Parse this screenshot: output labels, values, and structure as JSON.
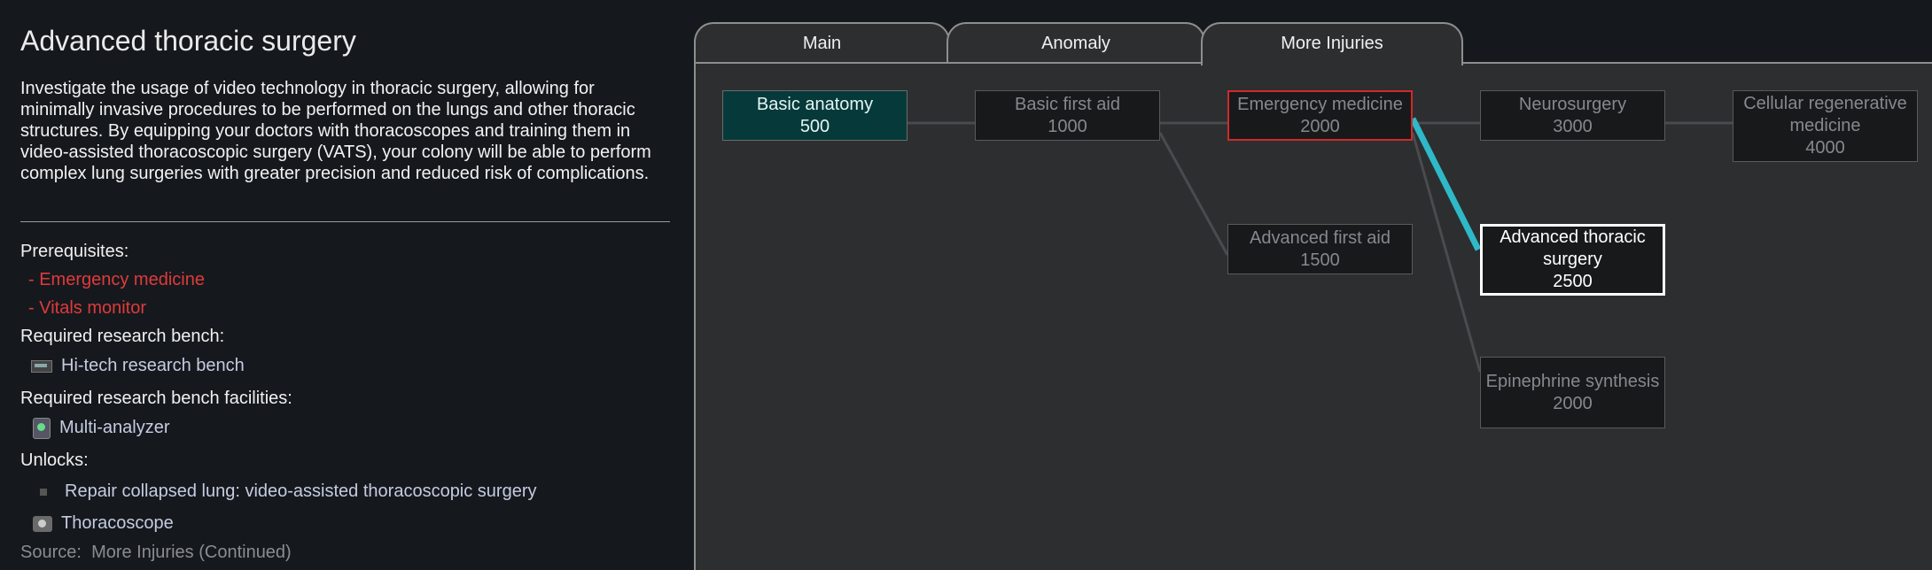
{
  "info": {
    "title": "Advanced thoracic surgery",
    "description": "Investigate the usage of video technology in thoracic surgery, allowing for minimally invasive procedures to be performed on the lungs and other thoracic structures. By equipping your doctors with thoracoscopes and training them in video-assisted thoracoscopic surgery (VATS), your colony will be able to perform complex lung surgeries with greater precision and reduced risk of complications.",
    "prerequisites_label": "Prerequisites:",
    "prerequisites": [
      "- Emergency medicine",
      "- Vitals monitor"
    ],
    "bench_label": "Required research bench:",
    "bench": "Hi-tech research bench",
    "facilities_label": "Required research bench facilities:",
    "facility": "Multi-analyzer",
    "unlocks_label": "Unlocks:",
    "unlocks": [
      "Repair collapsed lung: video-assisted thoracoscopic surgery",
      "Thoracoscope"
    ],
    "source_label": "Source:",
    "source": "More Injuries (Continued)"
  },
  "tabs": [
    "Main",
    "Anomaly",
    "More Injuries"
  ],
  "active_tab": "More Injuries",
  "nodes": [
    {
      "name": "Basic anatomy",
      "cost": "500",
      "state": "researched"
    },
    {
      "name": "Basic first aid",
      "cost": "1000",
      "state": "locked"
    },
    {
      "name": "Emergency medicine",
      "cost": "2000",
      "state": "prerequisite"
    },
    {
      "name": "Neurosurgery",
      "cost": "3000",
      "state": "locked"
    },
    {
      "name": "Cellular regenerative medicine",
      "cost": "4000",
      "state": "locked"
    },
    {
      "name": "Advanced first aid",
      "cost": "1500",
      "state": "locked"
    },
    {
      "name": "Advanced thoracic surgery",
      "cost": "2500",
      "state": "selected"
    },
    {
      "name": "Epinephrine synthesis",
      "cost": "2000",
      "state": "locked"
    }
  ],
  "colors": {
    "background": "#15191e",
    "tree_background": "#2d2e30",
    "researched": "#063a3a",
    "prerequisite_border": "#d02a2a",
    "highlight_link": "#2fb8c8",
    "missing_prerequisite_text": "#e03a3a"
  }
}
